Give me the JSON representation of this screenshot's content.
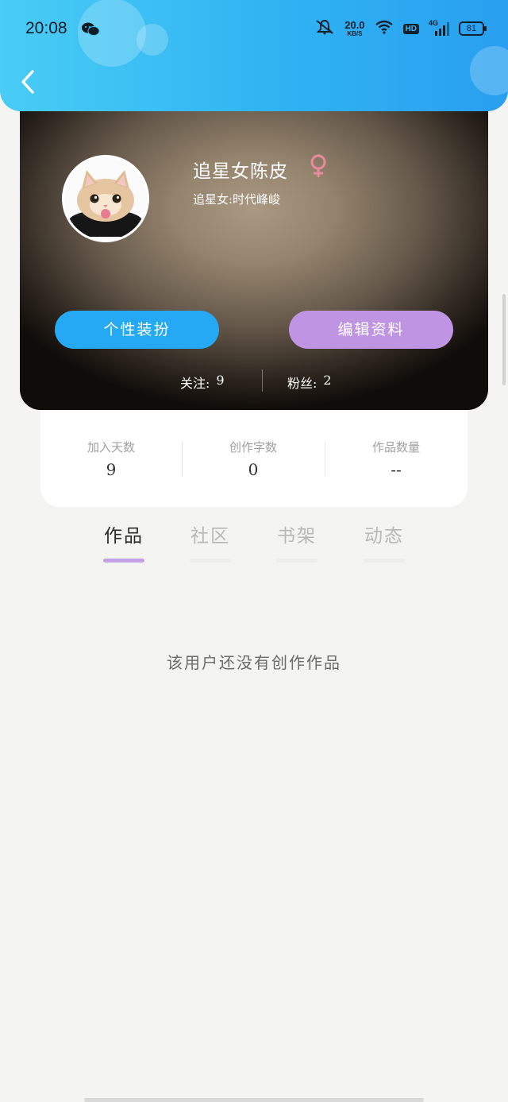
{
  "status_bar": {
    "time": "20:08",
    "speed_value": "20.0",
    "speed_unit": "KB/S",
    "hd": "HD",
    "network": "4G",
    "battery": "81"
  },
  "profile": {
    "username": "追星女陈皮",
    "signature": "追星女:时代峰峻",
    "gender_color": "#e8899c",
    "style_button": "个性装扮",
    "edit_button": "编辑资料",
    "following_label": "关注:",
    "following_value": "9",
    "followers_label": "粉丝:",
    "followers_value": "2"
  },
  "metrics": [
    {
      "label": "加入天数",
      "value": "9"
    },
    {
      "label": "创作字数",
      "value": "0"
    },
    {
      "label": "作品数量",
      "value": "--"
    }
  ],
  "tabs": [
    {
      "label": "作品",
      "active": true
    },
    {
      "label": "社区",
      "active": false
    },
    {
      "label": "书架",
      "active": false
    },
    {
      "label": "动态",
      "active": false
    }
  ],
  "empty_message": "该用户还没有创作作品",
  "colors": {
    "header_start": "#49ccf5",
    "header_end": "#2a9ff0",
    "style_button": "#26a9f5",
    "edit_button": "#bf95e3",
    "active_tab_underline": "#c3a1e6"
  }
}
